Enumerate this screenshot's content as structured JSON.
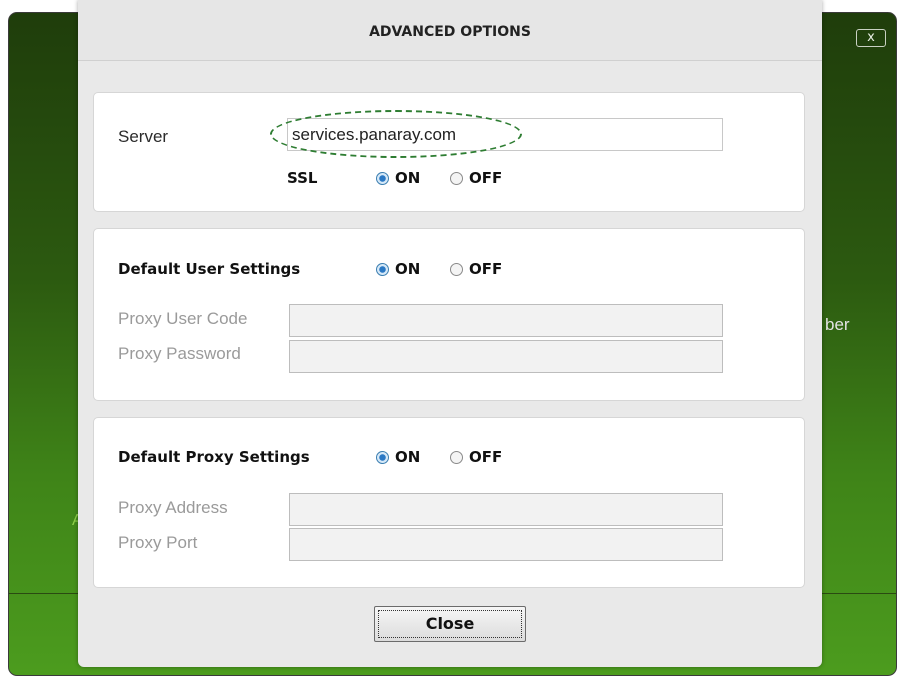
{
  "background": {
    "close_glyph": "x",
    "partial_text_right": "ber",
    "partial_text_left": "A"
  },
  "dialog": {
    "title": "ADVANCED OPTIONS",
    "server_section": {
      "server_label": "Server",
      "server_value": "services.panaray.com",
      "ssl_label": "SSL",
      "ssl_on_label": "ON",
      "ssl_off_label": "OFF",
      "ssl_selected": "ON"
    },
    "user_section": {
      "heading": "Default User Settings",
      "on_label": "ON",
      "off_label": "OFF",
      "selected": "ON",
      "proxy_user_code_label": "Proxy User Code",
      "proxy_user_code_value": "",
      "proxy_password_label": "Proxy Password",
      "proxy_password_value": ""
    },
    "proxy_section": {
      "heading": "Default Proxy Settings",
      "on_label": "ON",
      "off_label": "OFF",
      "selected": "ON",
      "proxy_address_label": "Proxy Address",
      "proxy_address_value": "",
      "proxy_port_label": "Proxy Port",
      "proxy_port_value": ""
    },
    "close_button_label": "Close"
  },
  "colors": {
    "background_window": "#2c5a10",
    "dialog_bg": "#e9e9e9",
    "radio_selected": "#2a78c4",
    "annotation_ellipse": "#2e7d32"
  }
}
